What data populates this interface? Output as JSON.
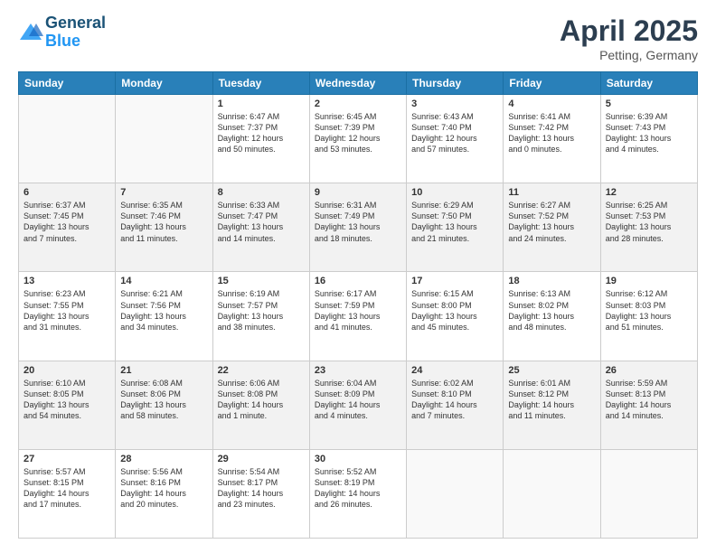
{
  "header": {
    "logo_line1": "General",
    "logo_line2": "Blue",
    "month": "April 2025",
    "location": "Petting, Germany"
  },
  "weekdays": [
    "Sunday",
    "Monday",
    "Tuesday",
    "Wednesday",
    "Thursday",
    "Friday",
    "Saturday"
  ],
  "weeks": [
    [
      {
        "day": "",
        "text": ""
      },
      {
        "day": "",
        "text": ""
      },
      {
        "day": "1",
        "text": "Sunrise: 6:47 AM\nSunset: 7:37 PM\nDaylight: 12 hours\nand 50 minutes."
      },
      {
        "day": "2",
        "text": "Sunrise: 6:45 AM\nSunset: 7:39 PM\nDaylight: 12 hours\nand 53 minutes."
      },
      {
        "day": "3",
        "text": "Sunrise: 6:43 AM\nSunset: 7:40 PM\nDaylight: 12 hours\nand 57 minutes."
      },
      {
        "day": "4",
        "text": "Sunrise: 6:41 AM\nSunset: 7:42 PM\nDaylight: 13 hours\nand 0 minutes."
      },
      {
        "day": "5",
        "text": "Sunrise: 6:39 AM\nSunset: 7:43 PM\nDaylight: 13 hours\nand 4 minutes."
      }
    ],
    [
      {
        "day": "6",
        "text": "Sunrise: 6:37 AM\nSunset: 7:45 PM\nDaylight: 13 hours\nand 7 minutes."
      },
      {
        "day": "7",
        "text": "Sunrise: 6:35 AM\nSunset: 7:46 PM\nDaylight: 13 hours\nand 11 minutes."
      },
      {
        "day": "8",
        "text": "Sunrise: 6:33 AM\nSunset: 7:47 PM\nDaylight: 13 hours\nand 14 minutes."
      },
      {
        "day": "9",
        "text": "Sunrise: 6:31 AM\nSunset: 7:49 PM\nDaylight: 13 hours\nand 18 minutes."
      },
      {
        "day": "10",
        "text": "Sunrise: 6:29 AM\nSunset: 7:50 PM\nDaylight: 13 hours\nand 21 minutes."
      },
      {
        "day": "11",
        "text": "Sunrise: 6:27 AM\nSunset: 7:52 PM\nDaylight: 13 hours\nand 24 minutes."
      },
      {
        "day": "12",
        "text": "Sunrise: 6:25 AM\nSunset: 7:53 PM\nDaylight: 13 hours\nand 28 minutes."
      }
    ],
    [
      {
        "day": "13",
        "text": "Sunrise: 6:23 AM\nSunset: 7:55 PM\nDaylight: 13 hours\nand 31 minutes."
      },
      {
        "day": "14",
        "text": "Sunrise: 6:21 AM\nSunset: 7:56 PM\nDaylight: 13 hours\nand 34 minutes."
      },
      {
        "day": "15",
        "text": "Sunrise: 6:19 AM\nSunset: 7:57 PM\nDaylight: 13 hours\nand 38 minutes."
      },
      {
        "day": "16",
        "text": "Sunrise: 6:17 AM\nSunset: 7:59 PM\nDaylight: 13 hours\nand 41 minutes."
      },
      {
        "day": "17",
        "text": "Sunrise: 6:15 AM\nSunset: 8:00 PM\nDaylight: 13 hours\nand 45 minutes."
      },
      {
        "day": "18",
        "text": "Sunrise: 6:13 AM\nSunset: 8:02 PM\nDaylight: 13 hours\nand 48 minutes."
      },
      {
        "day": "19",
        "text": "Sunrise: 6:12 AM\nSunset: 8:03 PM\nDaylight: 13 hours\nand 51 minutes."
      }
    ],
    [
      {
        "day": "20",
        "text": "Sunrise: 6:10 AM\nSunset: 8:05 PM\nDaylight: 13 hours\nand 54 minutes."
      },
      {
        "day": "21",
        "text": "Sunrise: 6:08 AM\nSunset: 8:06 PM\nDaylight: 13 hours\nand 58 minutes."
      },
      {
        "day": "22",
        "text": "Sunrise: 6:06 AM\nSunset: 8:08 PM\nDaylight: 14 hours\nand 1 minute."
      },
      {
        "day": "23",
        "text": "Sunrise: 6:04 AM\nSunset: 8:09 PM\nDaylight: 14 hours\nand 4 minutes."
      },
      {
        "day": "24",
        "text": "Sunrise: 6:02 AM\nSunset: 8:10 PM\nDaylight: 14 hours\nand 7 minutes."
      },
      {
        "day": "25",
        "text": "Sunrise: 6:01 AM\nSunset: 8:12 PM\nDaylight: 14 hours\nand 11 minutes."
      },
      {
        "day": "26",
        "text": "Sunrise: 5:59 AM\nSunset: 8:13 PM\nDaylight: 14 hours\nand 14 minutes."
      }
    ],
    [
      {
        "day": "27",
        "text": "Sunrise: 5:57 AM\nSunset: 8:15 PM\nDaylight: 14 hours\nand 17 minutes."
      },
      {
        "day": "28",
        "text": "Sunrise: 5:56 AM\nSunset: 8:16 PM\nDaylight: 14 hours\nand 20 minutes."
      },
      {
        "day": "29",
        "text": "Sunrise: 5:54 AM\nSunset: 8:17 PM\nDaylight: 14 hours\nand 23 minutes."
      },
      {
        "day": "30",
        "text": "Sunrise: 5:52 AM\nSunset: 8:19 PM\nDaylight: 14 hours\nand 26 minutes."
      },
      {
        "day": "",
        "text": ""
      },
      {
        "day": "",
        "text": ""
      },
      {
        "day": "",
        "text": ""
      }
    ]
  ]
}
